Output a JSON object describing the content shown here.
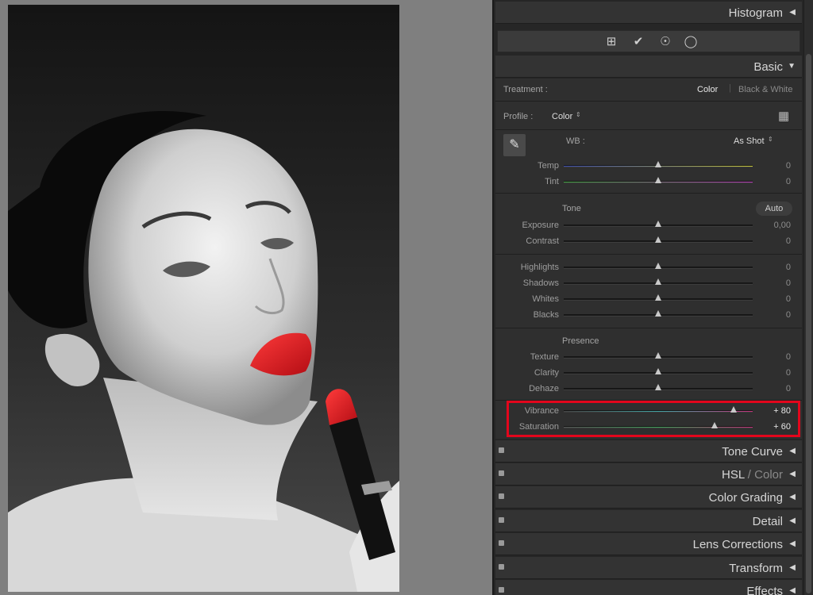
{
  "panel": {
    "histogram_label": "Histogram",
    "basic_label": "Basic",
    "treatment": {
      "label": "Treatment :",
      "color": "Color",
      "bw": "Black & White"
    },
    "profile": {
      "label": "Profile :",
      "value": "Color"
    },
    "wb": {
      "label": "WB :",
      "value": "As Shot"
    },
    "tone_label": "Tone",
    "auto_label": "Auto",
    "presence_label": "Presence",
    "sliders": {
      "temp": {
        "label": "Temp",
        "value": "0",
        "position": 0.5
      },
      "tint": {
        "label": "Tint",
        "value": "0",
        "position": 0.5
      },
      "exposure": {
        "label": "Exposure",
        "value": "0,00",
        "position": 0.5
      },
      "contrast": {
        "label": "Contrast",
        "value": "0",
        "position": 0.5
      },
      "highlights": {
        "label": "Highlights",
        "value": "0",
        "position": 0.5
      },
      "shadows": {
        "label": "Shadows",
        "value": "0",
        "position": 0.5
      },
      "whites": {
        "label": "Whites",
        "value": "0",
        "position": 0.5
      },
      "blacks": {
        "label": "Blacks",
        "value": "0",
        "position": 0.5
      },
      "texture": {
        "label": "Texture",
        "value": "0",
        "position": 0.5
      },
      "clarity": {
        "label": "Clarity",
        "value": "0",
        "position": 0.5
      },
      "dehaze": {
        "label": "Dehaze",
        "value": "0",
        "position": 0.5
      },
      "vibrance": {
        "label": "Vibrance",
        "value": "+ 80",
        "position": 0.9
      },
      "saturation": {
        "label": "Saturation",
        "value": "+ 60",
        "position": 0.8
      }
    },
    "sections": {
      "tone_curve": "Tone Curve",
      "hsl": "HSL",
      "hsl_sep": " / ",
      "hsl_color": "Color",
      "color_grading": "Color Grading",
      "detail": "Detail",
      "lens_corrections": "Lens Corrections",
      "transform": "Transform",
      "effects": "Effects"
    },
    "icons": {
      "crop": "crop-icon",
      "heal": "healing-icon",
      "redeye": "red-eye-icon",
      "mask": "mask-icon",
      "eyedropper": "eyedropper-icon",
      "grid": "profile-grid-icon"
    }
  },
  "colors": {
    "highlight": "#e3061c",
    "lipstick": "#d8141e"
  }
}
